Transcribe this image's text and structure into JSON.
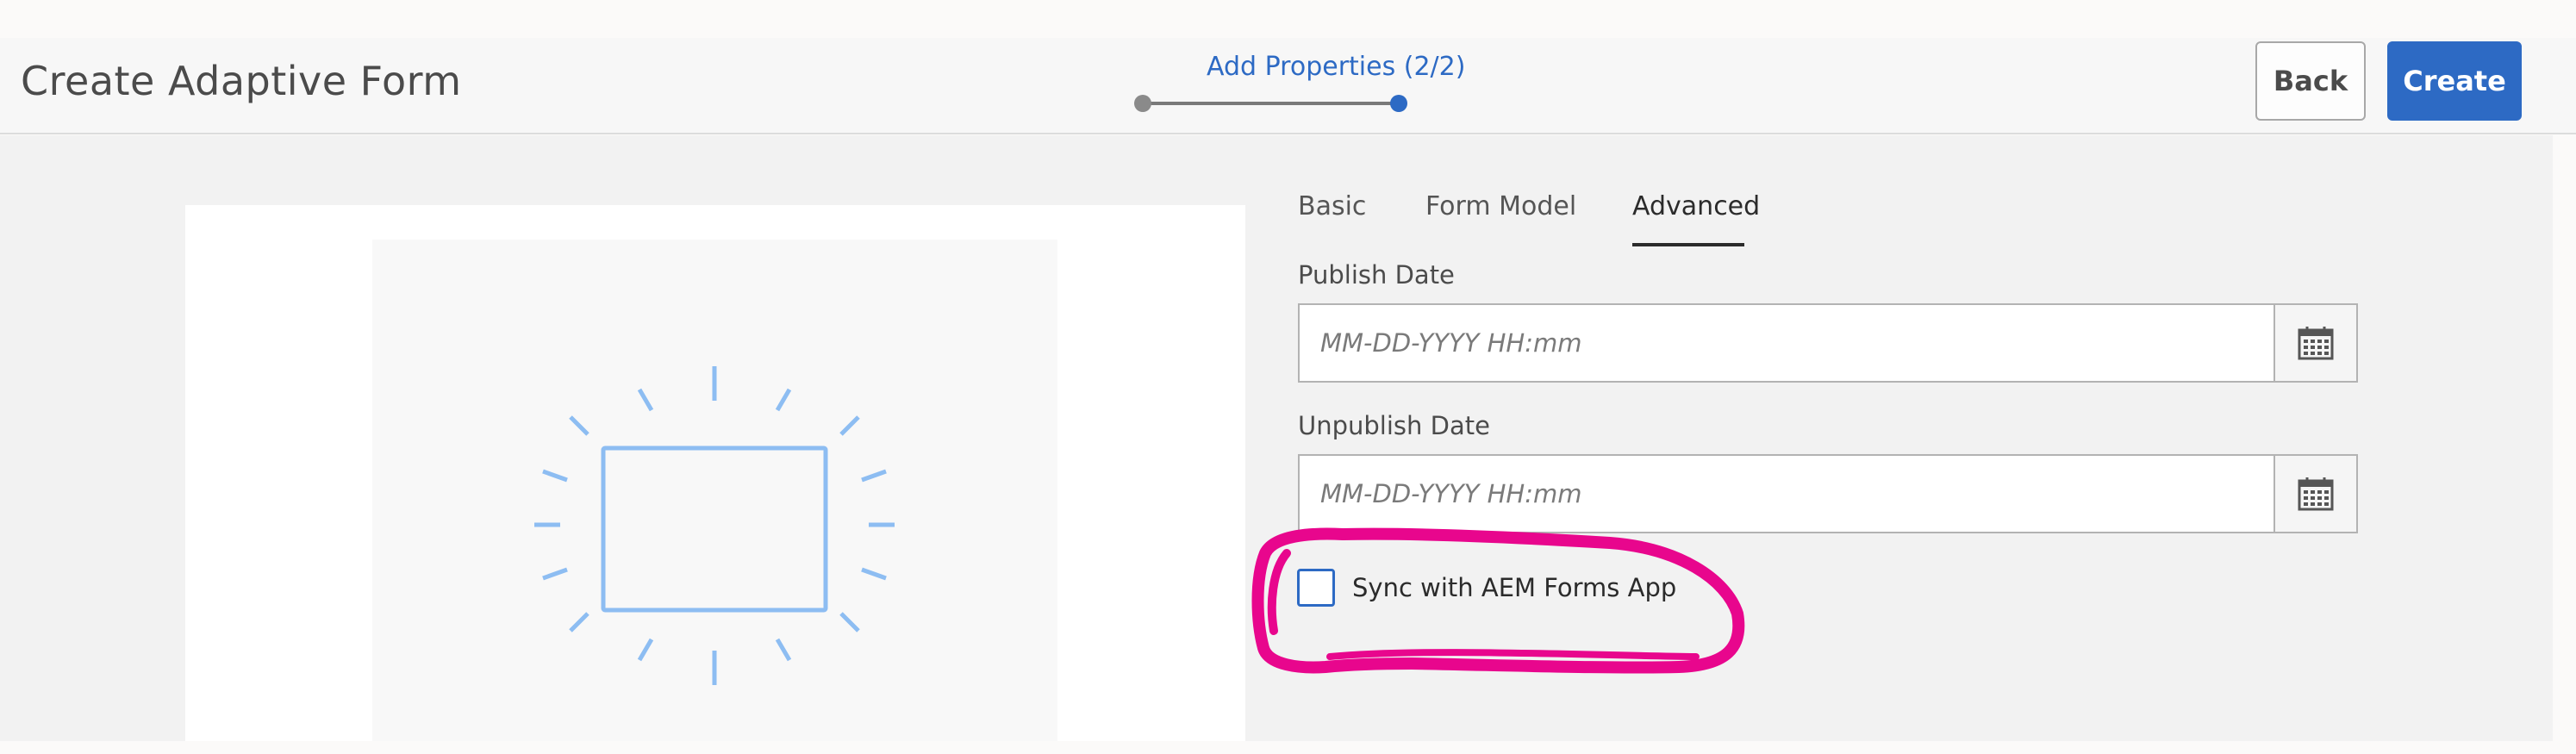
{
  "header": {
    "title": "Create Adaptive Form",
    "step_label": "Add Properties (2/2)",
    "back_label": "Back",
    "create_label": "Create"
  },
  "tabs": [
    {
      "label": "Basic",
      "selected": false
    },
    {
      "label": "Form Model",
      "selected": false
    },
    {
      "label": "Advanced",
      "selected": true
    }
  ],
  "publish_date": {
    "label": "Publish Date",
    "placeholder": "MM-DD-YYYY HH:mm",
    "value": ""
  },
  "unpublish_date": {
    "label": "Unpublish Date",
    "placeholder": "MM-DD-YYYY HH:mm",
    "value": ""
  },
  "sync": {
    "label": "Sync with AEM Forms App",
    "checked": false
  },
  "icons": {
    "calendar": "calendar-icon",
    "preview": "form-template-preview-icon"
  },
  "colors": {
    "accent": "#2d6ac4",
    "annotation": "#e8068d",
    "illustration": "#8dbdf2"
  }
}
